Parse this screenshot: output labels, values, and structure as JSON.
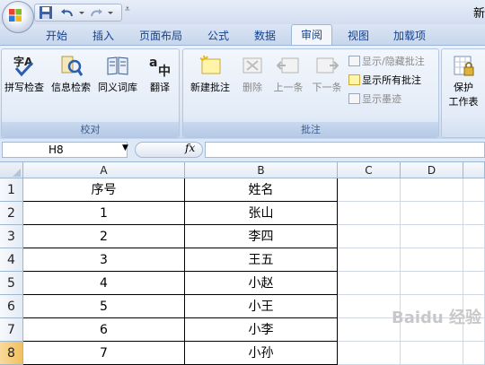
{
  "window": {
    "title": "新"
  },
  "tabs": [
    "开始",
    "插入",
    "页面布局",
    "公式",
    "数据",
    "审阅",
    "视图",
    "加载项"
  ],
  "active_tab": "审阅",
  "ribbon": {
    "proofing": {
      "label": "校对",
      "buttons": [
        "拼写检查",
        "信息检索",
        "同义词库",
        "翻译"
      ]
    },
    "comments": {
      "label": "批注",
      "new_comment": "新建批注",
      "delete": "删除",
      "previous": "上一条",
      "next": "下一条",
      "show_hide": "显示/隐藏批注",
      "show_all": "显示所有批注",
      "show_ink": "显示墨迹"
    },
    "protect": {
      "line1": "保护",
      "line2": "工作表"
    }
  },
  "formula_bar": {
    "name_box": "H8",
    "fx": "fx",
    "value": ""
  },
  "sheet": {
    "columns": [
      "A",
      "B",
      "C",
      "D"
    ],
    "rows": [
      "1",
      "2",
      "3",
      "4",
      "5",
      "6",
      "7",
      "8"
    ],
    "selected_row": "8",
    "cells": [
      [
        "序号",
        "姓名"
      ],
      [
        "1",
        "张山"
      ],
      [
        "2",
        "李四"
      ],
      [
        "3",
        "王五"
      ],
      [
        "4",
        "小赵"
      ],
      [
        "5",
        "小王"
      ],
      [
        "6",
        "小李"
      ],
      [
        "7",
        "小孙"
      ]
    ]
  },
  "watermark": "Baidu 经验"
}
